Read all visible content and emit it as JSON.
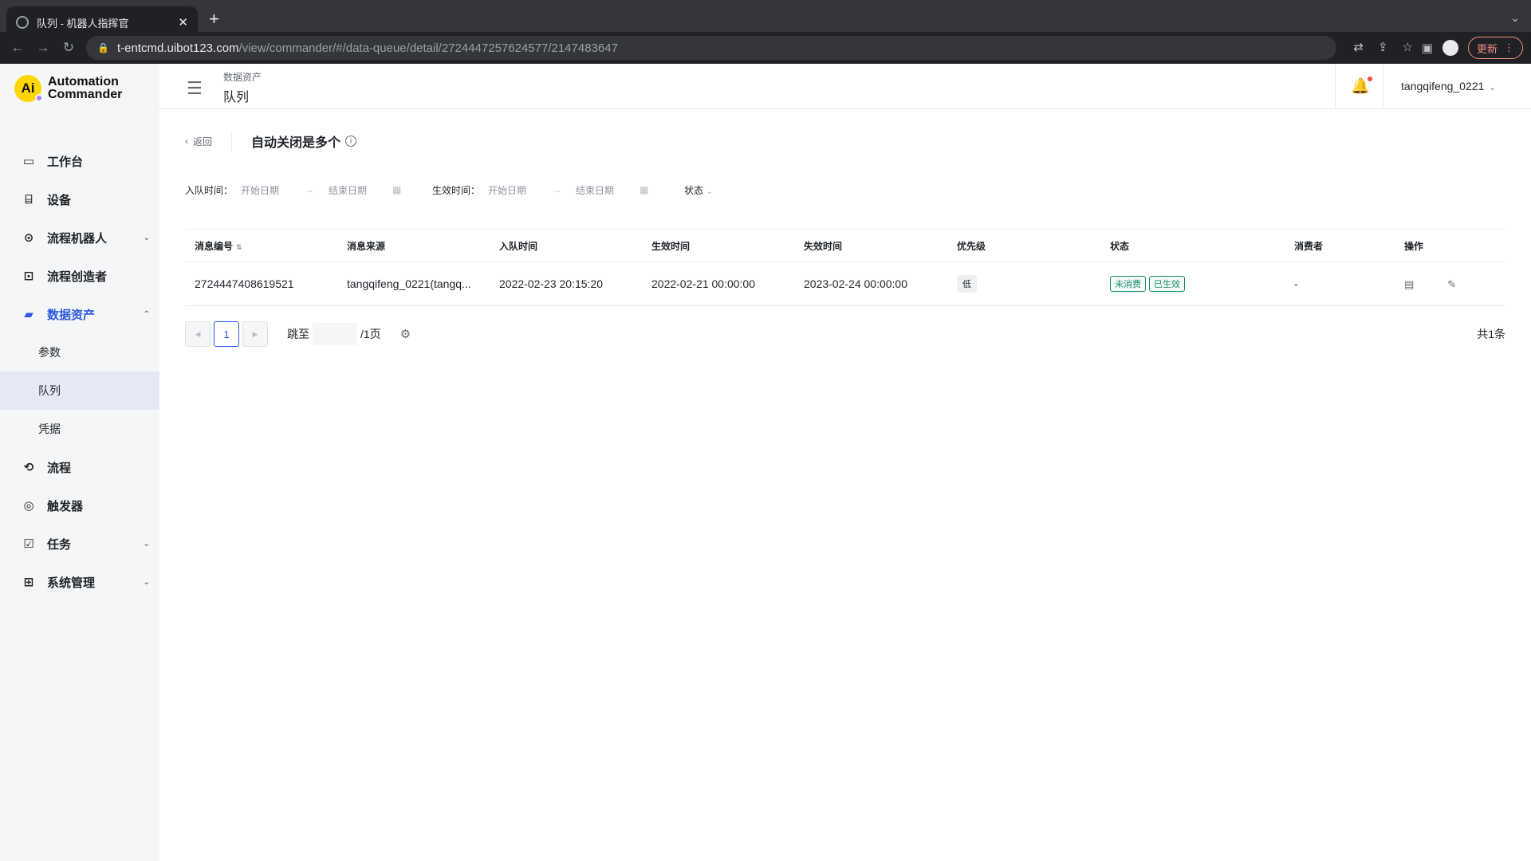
{
  "browser": {
    "tab_title": "队列 - 机器人指挥官",
    "tab_close": "✕",
    "new_tab": "+",
    "url_host": "t-entcmd.uibot123.com",
    "url_path": "/view/commander/#/data-queue/detail/2724447257624577/2147483647",
    "update_label": "更新"
  },
  "app": {
    "logo_line1": "Automation",
    "logo_line2": "Commander",
    "logo_mark": "Ai"
  },
  "sidebar": {
    "items": [
      {
        "label": "工作台",
        "icon": "dashboard-icon"
      },
      {
        "label": "设备",
        "icon": "device-icon"
      },
      {
        "label": "流程机器人",
        "icon": "robot-icon",
        "expandable": true
      },
      {
        "label": "流程创造者",
        "icon": "creator-icon"
      },
      {
        "label": "数据资产",
        "icon": "folder-icon",
        "expanded": true,
        "active": true
      },
      {
        "label": "流程",
        "icon": "process-icon"
      },
      {
        "label": "触发器",
        "icon": "trigger-icon"
      },
      {
        "label": "任务",
        "icon": "task-icon",
        "expandable": true
      },
      {
        "label": "系统管理",
        "icon": "settings-icon",
        "expandable": true
      }
    ],
    "sub_items": [
      "参数",
      "队列",
      "凭据"
    ]
  },
  "header": {
    "breadcrumb_parent": "数据资产",
    "breadcrumb_current": "队列",
    "username": "tangqifeng_0221"
  },
  "page": {
    "back_label": "返回",
    "title": "自动关闭是多个",
    "info": "i"
  },
  "filters": {
    "enqueue_label": "入队时间：",
    "effective_label": "生效时间：",
    "start_placeholder": "开始日期",
    "end_placeholder": "结束日期",
    "status_label": "状态"
  },
  "table": {
    "columns": [
      "消息编号",
      "消息来源",
      "入队时间",
      "生效时间",
      "失效时间",
      "优先级",
      "状态",
      "消费者",
      "操作"
    ],
    "rows": [
      {
        "id": "2724447408619521",
        "source": "tangqifeng_0221(tangq...",
        "enqueue_time": "2022-02-23 20:15:20",
        "effective_time": "2022-02-21 00:00:00",
        "expire_time": "2023-02-24 00:00:00",
        "priority": "低",
        "status_tags": [
          "未消费",
          "已生效"
        ],
        "consumer": "-"
      }
    ]
  },
  "pagination": {
    "current_page": "1",
    "jump_label": "跳至",
    "pages_total": "/1页",
    "total_count": "共1条"
  },
  "colors": {
    "accent": "#2b5ae0",
    "tag_green": "#1a8a6b",
    "sidebar_bg": "#f5f6f7",
    "notification_dot": "#f54a45"
  }
}
